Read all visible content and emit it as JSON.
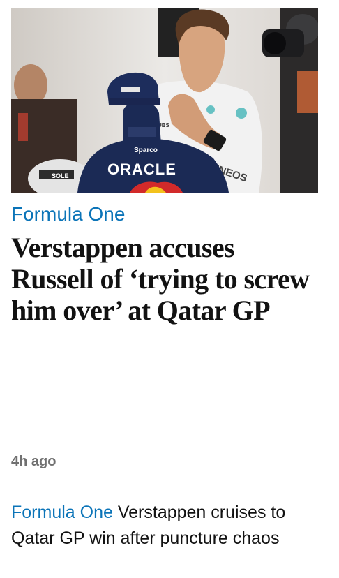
{
  "card": {
    "image_alt": "Max Verstappen and George Russell in the paddock",
    "photo_text": {
      "sponsor_main": "ORACLE",
      "sponsor_small": "Sparco",
      "sponsor_side": "INEOS",
      "helmet_text": "SOLE",
      "shirt_badge": "UBS"
    },
    "kicker": "Formula One",
    "headline": "Verstappen accuses Russell of ‘trying to screw him over’ at Qatar GP",
    "age": "4h ago"
  },
  "related": {
    "kicker": "Formula One",
    "title": "Verstappen cruises to Qatar GP win after puncture chaos"
  },
  "colors": {
    "kicker": "#0b74b8",
    "headline": "#121212",
    "age": "#707070",
    "divider": "#cfcfcf"
  }
}
